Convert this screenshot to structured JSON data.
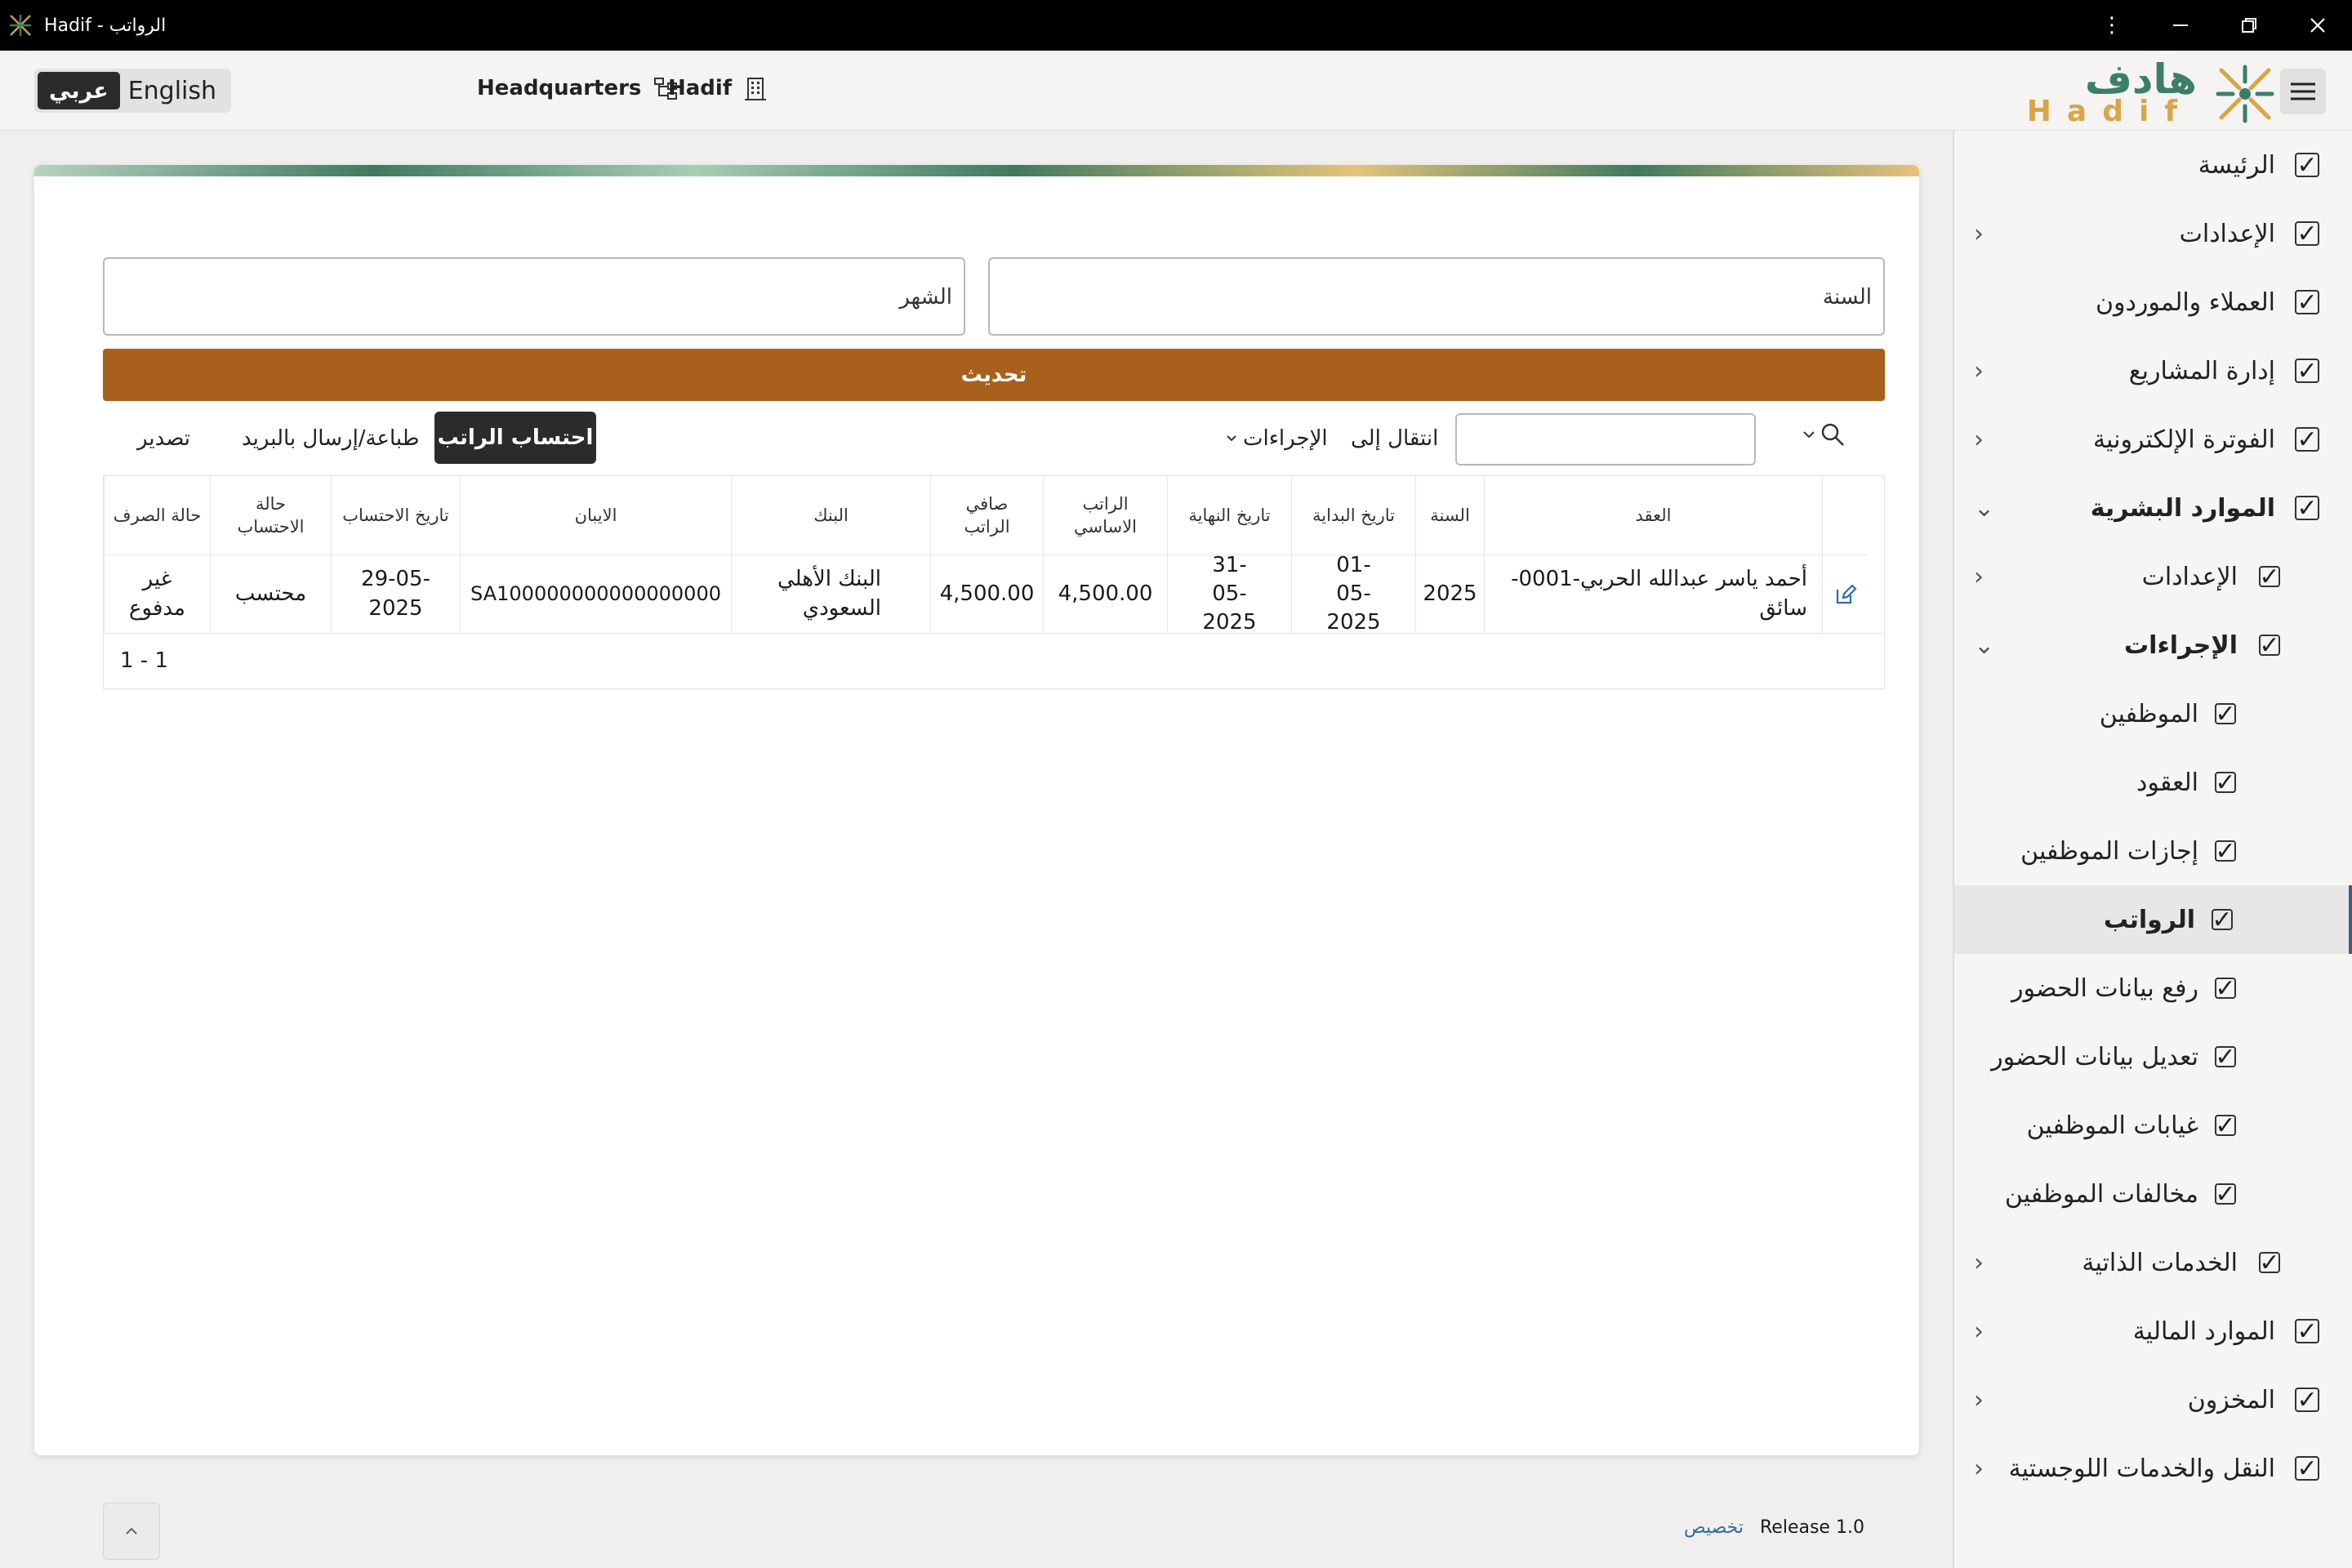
{
  "window": {
    "title": "Hadif - الرواتب"
  },
  "header": {
    "lang_arabic": "عربي",
    "lang_english": "English",
    "headquarters": "Headquarters",
    "organization": "Hadif",
    "logo_ar": "هادف",
    "logo_en": "Hadif"
  },
  "sidebar": {
    "items": [
      {
        "label": "الرئيسة"
      },
      {
        "label": "الإعدادات"
      },
      {
        "label": "العملاء والموردون"
      },
      {
        "label": "إدارة المشاريع"
      },
      {
        "label": "الفوترة الإلكترونية"
      },
      {
        "label": "الموارد البشرية"
      },
      {
        "label": "الإعدادات"
      },
      {
        "label": "الإجراءات"
      },
      {
        "label": "الموظفين"
      },
      {
        "label": "العقود"
      },
      {
        "label": "إجازات الموظفين"
      },
      {
        "label": "الرواتب"
      },
      {
        "label": "رفع بيانات الحضور"
      },
      {
        "label": "تعديل بيانات الحضور"
      },
      {
        "label": "غيابات الموظفين"
      },
      {
        "label": "مخالفات الموظفين"
      },
      {
        "label": "الخدمات الذاتية"
      },
      {
        "label": "الموارد المالية"
      },
      {
        "label": "المخزون"
      },
      {
        "label": "النقل والخدمات اللوجستية"
      }
    ]
  },
  "form": {
    "year_label": "السنة",
    "month_label": "الشهر",
    "refresh_label": "تحديث"
  },
  "toolbar": {
    "goto": "انتقال إلى",
    "actions": "الإجراءات",
    "calc_salary": "احتساب الراتب",
    "print_email": "طباعة/إرسال بالبريد",
    "export": "تصدير"
  },
  "table": {
    "headers": {
      "contract": "العقد",
      "year": "السنة",
      "start_date": "تاريخ البداية",
      "end_date": "تاريخ النهاية",
      "basic_salary": "الراتب الاساسي",
      "net_salary": "صافي الراتب",
      "bank": "البنك",
      "iban": "الايبان",
      "calc_date": "تاريخ الاحتساب",
      "calc_status": "حالة الاحتساب",
      "payment_status": "حالة الصرف"
    },
    "rows": [
      {
        "contract": "أحمد ياسر عبدالله الحربي-0001-سائق",
        "year": "2025",
        "start_date": "01-05-2025",
        "end_date": "31-05-2025",
        "basic_salary": "4,500.00",
        "net_salary": "4,500.00",
        "bank": "البنك الأهلي السعودي",
        "iban": "SA100000000000000000",
        "calc_date": "29-05-2025",
        "calc_status": "محتسب",
        "payment_status": "غير مدفوع"
      }
    ],
    "pagination": "1 - 1"
  },
  "footer": {
    "release": "Release 1.0",
    "customize": "تخصيص"
  }
}
